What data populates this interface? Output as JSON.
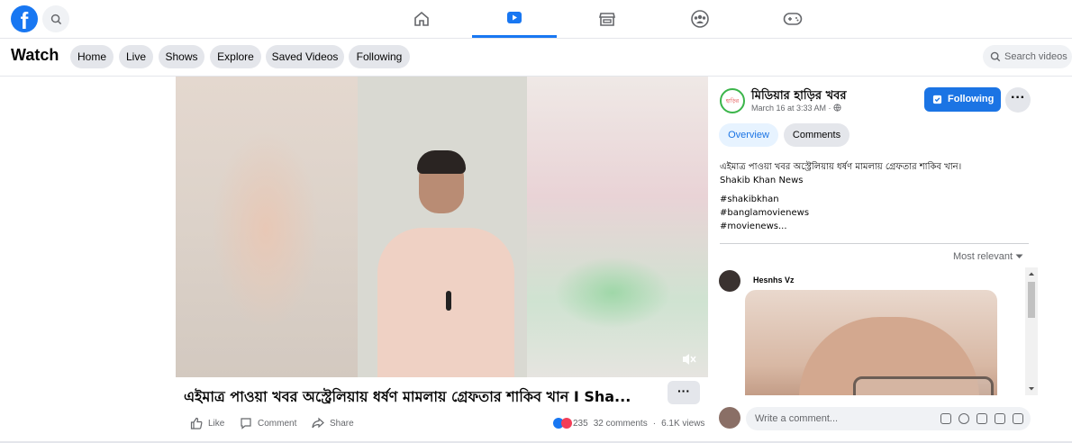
{
  "topnav": {
    "logo": "f",
    "tabs": [
      {
        "icon": "home-icon"
      },
      {
        "icon": "watch-icon",
        "active": true
      },
      {
        "icon": "marketplace-icon"
      },
      {
        "icon": "groups-icon"
      },
      {
        "icon": "gaming-icon"
      }
    ],
    "accent": "#1877f2"
  },
  "watch_bar": {
    "title": "Watch",
    "pills": [
      "Home",
      "Live",
      "Shows",
      "Explore",
      "Saved Videos",
      "Following"
    ],
    "search_placeholder": "Search videos"
  },
  "video": {
    "title": "এইমাত্র পাওয়া খবর অস্ট্রেলিয়ায় ধর্ষণ মামলায় গ্রেফতার শাকিব খান I Sha...",
    "more": "···",
    "actions": {
      "like": "Like",
      "comment": "Comment",
      "share": "Share"
    },
    "reactions_count": "235",
    "comments_count": "32 comments",
    "views": "6.1K views"
  },
  "side": {
    "page_name": "মিডিয়ার হাড়ির খবর",
    "avatar_text": "হাড়ির",
    "date": "March 16 at 3:33 AM · ",
    "follow_label": "Following",
    "more": "···",
    "tabs": {
      "overview": "Overview",
      "comments": "Comments"
    },
    "description_line1": "এইমাত্র পাওয়া খবর অস্ট্রেলিয়ায় ধর্ষণ মামলায় গ্রেফতার শাকিব খান।",
    "description_line2": "Shakib Khan News",
    "hashtags": [
      "#shakibkhan",
      "#banglamovienews",
      "#movienews..."
    ],
    "sort_label": "Most relevant",
    "comment": {
      "author": "Hesnhs Vz"
    },
    "write_placeholder": "Write a comment..."
  }
}
